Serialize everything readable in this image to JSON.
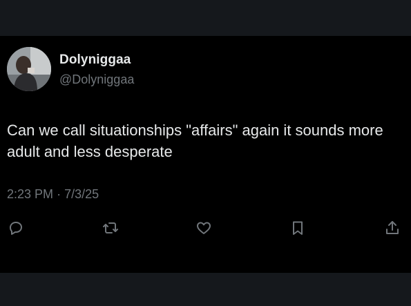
{
  "tweet": {
    "display_name": "Dolyniggaa",
    "handle": "@Dolyniggaa",
    "text": "Can we call situationships \"affairs\" again it sounds more adult and less desperate",
    "time": "2:23 PM",
    "separator": "·",
    "date": "7/3/25"
  },
  "actions": [
    {
      "icon": "reply-icon"
    },
    {
      "icon": "retweet-icon"
    },
    {
      "icon": "like-icon"
    },
    {
      "icon": "bookmark-icon"
    },
    {
      "icon": "share-icon"
    }
  ],
  "colors": {
    "background": "#000000",
    "band": "#15181c",
    "text_primary": "#e7e9ea",
    "text_secondary": "#71767b"
  }
}
